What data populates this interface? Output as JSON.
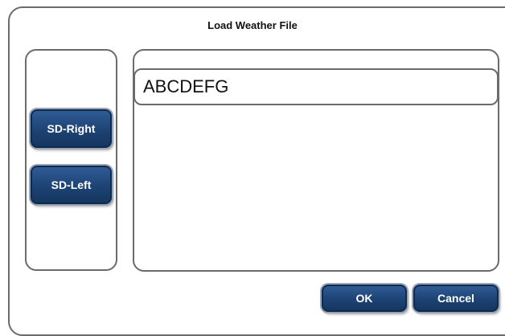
{
  "dialog": {
    "title": "Load Weather File"
  },
  "sources": {
    "sd_right": "SD-Right",
    "sd_left": "SD-Left"
  },
  "files": {
    "items": [
      {
        "name": "ABCDEFG"
      }
    ]
  },
  "actions": {
    "ok": "OK",
    "cancel": "Cancel"
  },
  "colors": {
    "button_fill": "#1d4374",
    "border": "#6b6b6b"
  }
}
